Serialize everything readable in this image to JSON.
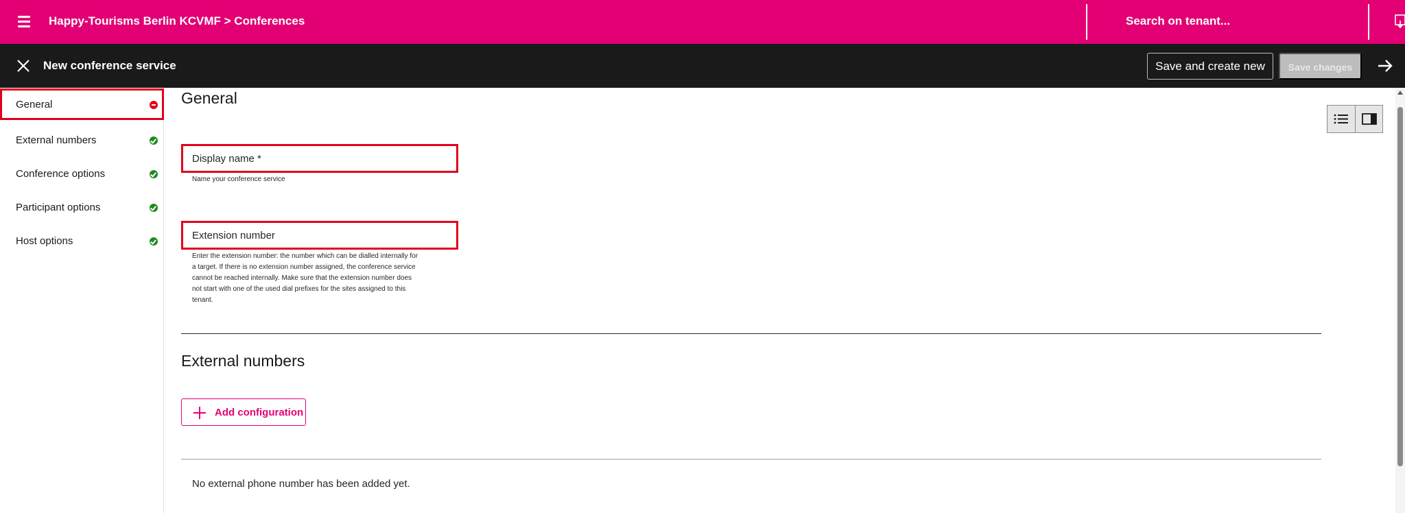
{
  "topbar": {
    "breadcrumb": "Happy-Tourisms Berlin KCVMF > Conferences",
    "search_label": "Search on tenant...",
    "menu_icon": "hamburger-menu-icon",
    "brand_color": "#e20074"
  },
  "actionbar": {
    "title": "New conference service",
    "save_and_create_new_label": "Save and create new",
    "save_changes_label": "Save changes",
    "close_icon": "close-icon",
    "next_icon": "arrow-right-icon"
  },
  "sidenav": {
    "items": [
      {
        "label": "General",
        "status": "error",
        "active": true
      },
      {
        "label": "External numbers",
        "status": "ok",
        "active": false
      },
      {
        "label": "Conference options",
        "status": "ok",
        "active": false
      },
      {
        "label": "Participant options",
        "status": "ok",
        "active": false
      },
      {
        "label": "Host options",
        "status": "ok",
        "active": false
      }
    ]
  },
  "main": {
    "general_title": "General",
    "display_name": {
      "label": "Display name *",
      "helper": "Name your conference service"
    },
    "extension_number": {
      "label": "Extension number",
      "helper_lines": [
        "Enter the extension number: the number which can be dialled internally for",
        "a target. If there is no extension number assigned, the conference service",
        "cannot be reached internally. Make sure that the extension number does",
        "not start with one of the used dial prefixes for the sites assigned to this",
        "tenant."
      ]
    },
    "external_numbers_title": "External numbers",
    "add_configuration_label": "Add configuration",
    "empty_message": "No external phone number has been added yet."
  },
  "view_toggle": {
    "left_icon": "list-view-icon",
    "right_icon": "side-panel-view-icon"
  }
}
